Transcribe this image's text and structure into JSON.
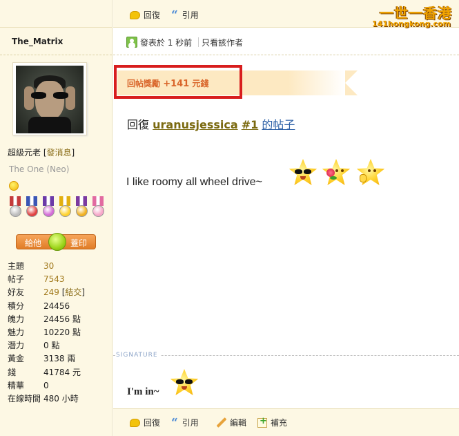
{
  "site_logo": {
    "chinese": "一世一香港",
    "domain": "141hongkong.com"
  },
  "top_actions": [
    {
      "label": "回復",
      "icon": "reply-icon"
    },
    {
      "label": "引用",
      "icon": "quote-icon"
    }
  ],
  "author": {
    "name": "The_Matrix",
    "avatar": "neo-avatar",
    "rank": "超級元老",
    "message_link": "發消息",
    "custom_title": "The One (Neo)",
    "stamp_button": {
      "left": "給他",
      "right": "蓋印"
    },
    "medals": [
      {
        "icon": "medal-gear-icon",
        "ribbon": "#c43b3b",
        "disc": "#bdbdbd"
      },
      {
        "icon": "medal-heart-icon",
        "ribbon": "#3a56b5",
        "disc": "#e04040"
      },
      {
        "icon": "medal-flower-icon",
        "ribbon": "#6b3aa8",
        "disc": "#d36ad6"
      },
      {
        "icon": "medal-smile-icon",
        "ribbon": "#e2b010",
        "disc": "#ffd22e"
      },
      {
        "icon": "medal-sun-icon",
        "ribbon": "#7b3aa0",
        "disc": "#f0b020"
      },
      {
        "icon": "medal-heart-pink-icon",
        "ribbon": "#e26aa0",
        "disc": "#f7a6c8"
      }
    ],
    "stats": [
      {
        "key": "主題",
        "value": "30",
        "link": true
      },
      {
        "key": "帖子",
        "value": "7543",
        "link": true
      },
      {
        "key": "好友",
        "value": "249",
        "link": true,
        "extra": "結交"
      },
      {
        "key": "積分",
        "value": "24456"
      },
      {
        "key": "魄力",
        "value": "24456 點"
      },
      {
        "key": "魅力",
        "value": "10220 點"
      },
      {
        "key": "潛力",
        "value": "0 點"
      },
      {
        "key": "黃金",
        "value": "3138 兩"
      },
      {
        "key": "錢",
        "value": "41784 元"
      },
      {
        "key": "精華",
        "value": "0"
      },
      {
        "key": "在線時間",
        "value": "480 小時"
      }
    ]
  },
  "post": {
    "posted_at": "發表於 1 秒前",
    "author_only": "只看該作者",
    "reward": {
      "label": "回帖獎勵",
      "amount": "+141",
      "unit": "元錢"
    },
    "reply_prefix": "回復",
    "reply_user": "uranusjessica",
    "reply_floor": "#1",
    "reply_suffix": "的帖子",
    "body": "I like roomy all wheel drive~",
    "emoticons": [
      "cool-star-icon",
      "rose-star-icon",
      "thumbs-up-star-icon"
    ],
    "signature_label": "SIGNATURE",
    "signature_text": "I'm in~",
    "signature_emoticon": "cool-star-icon"
  },
  "bottom_actions": [
    {
      "label": "回復",
      "icon": "reply-icon"
    },
    {
      "label": "引用",
      "icon": "quote-icon"
    },
    {
      "label": "編輯",
      "icon": "edit-icon"
    },
    {
      "label": "補充",
      "icon": "add-icon"
    }
  ]
}
